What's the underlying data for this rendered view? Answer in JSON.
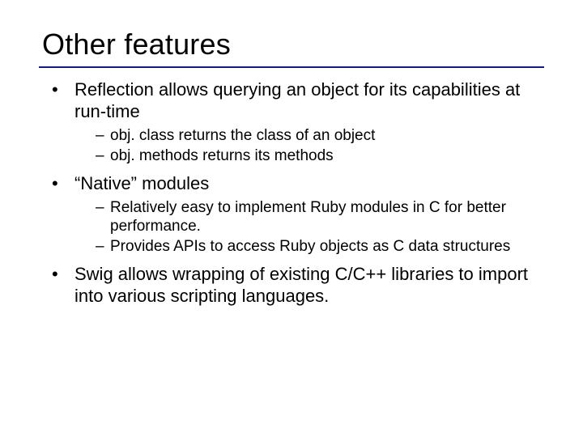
{
  "title": "Other features",
  "bullets": {
    "b1": "Reflection allows querying an object for its capabilities at run-time",
    "b1_sub": {
      "s1_pre": "obj. class",
      "s1_post": " returns the class of an object",
      "s2_pre": "obj. methods",
      "s2_post": " returns its methods"
    },
    "b2": "“Native” modules",
    "b2_sub": {
      "s1": "Relatively easy to implement Ruby modules in C for better performance.",
      "s2": "Provides APIs to access Ruby objects as C data structures"
    },
    "b3": "Swig allows wrapping of existing C/C++ libraries to import into various scripting languages."
  }
}
